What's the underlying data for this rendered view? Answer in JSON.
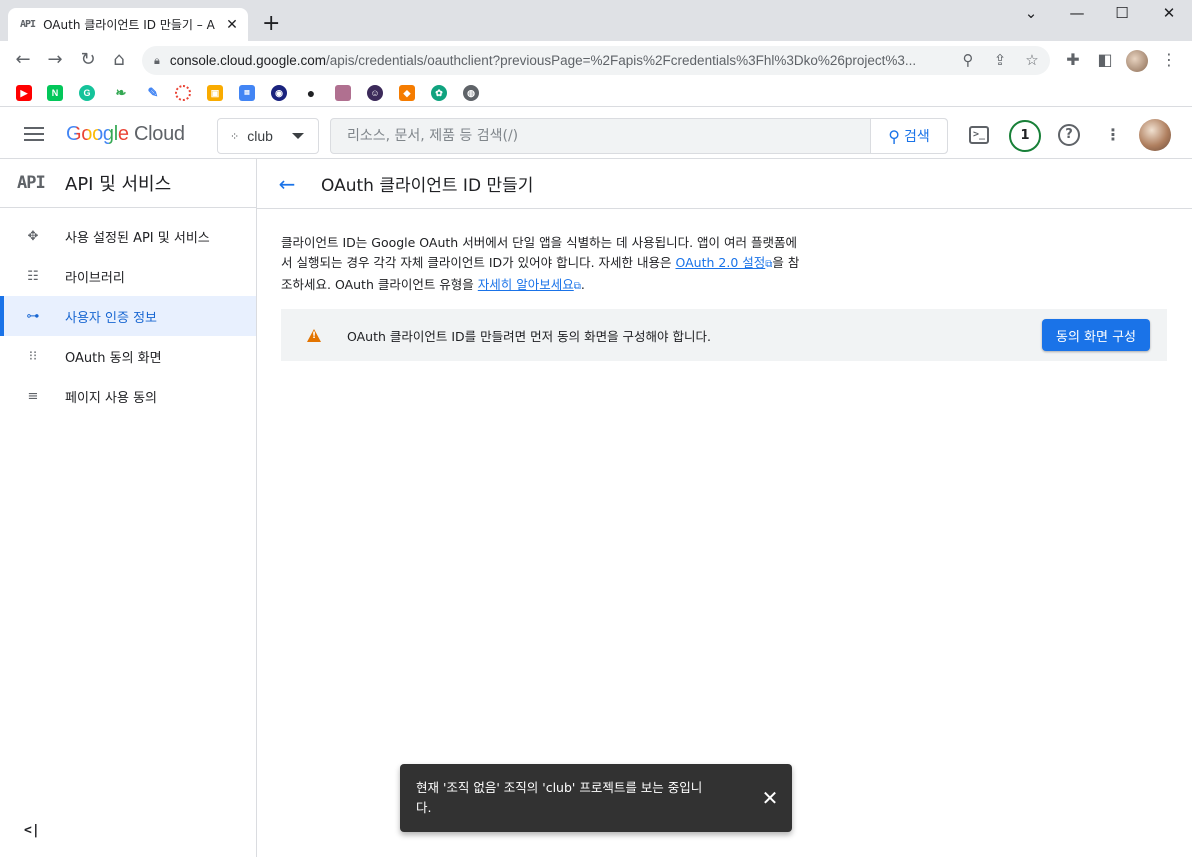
{
  "browser": {
    "tab_title": "OAuth 클라이언트 ID 만들기 – A",
    "tab_favicon": "API",
    "url_host": "console.cloud.google.com",
    "url_path": "/apis/credentials/oauthclient?previousPage=%2Fapis%2Fcredentials%3Fhl%3Dko%26project%3...",
    "bookmarks": [
      "youtube-icon",
      "naver-icon",
      "grammarly-icon",
      "leaf-icon",
      "feather-icon",
      "target-icon",
      "classroom-icon",
      "app-icon",
      "owl-icon",
      "github-icon",
      "photo-icon",
      "robot-icon",
      "box-icon",
      "openai-icon",
      "globe-icon"
    ]
  },
  "header": {
    "logo_google": "Google",
    "logo_cloud": "Cloud",
    "project_name": "club",
    "search_placeholder": "리소스, 문서, 제품 등 검색(/)",
    "search_button": "검색",
    "notifications_count": "1",
    "terminal_glyph": ">_",
    "help_glyph": "?"
  },
  "sidebar": {
    "head_icon": "API",
    "title": "API 및 서비스",
    "items": [
      {
        "label": "사용 설정된 API 및 서비스",
        "icon": "apis-icon",
        "glyph": "✥"
      },
      {
        "label": "라이브러리",
        "icon": "library-icon",
        "glyph": "☷"
      },
      {
        "label": "사용자 인증 정보",
        "icon": "key-icon",
        "glyph": "⊶"
      },
      {
        "label": "OAuth 동의 화면",
        "icon": "consent-icon",
        "glyph": "⁝⁝"
      },
      {
        "label": "페이지 사용 동의",
        "icon": "page-agreement-icon",
        "glyph": "≡"
      }
    ],
    "collapse_glyph": "<|"
  },
  "main": {
    "title": "OAuth 클라이언트 ID 만들기",
    "desc_part1": "클라이언트 ID는 Google OAuth 서버에서 단일 앱을 식별하는 데 사용됩니다. 앱이 여러 플랫폼에서 실행되는 경우 각각 자체 클라이언트 ID가 있어야 합니다. 자세한 내용은 ",
    "desc_link1": "OAuth 2.0 설정",
    "desc_part2": "을 참조하세요. OAuth 클라이언트 유형을 ",
    "desc_link2": "자세히 알아보세요",
    "desc_part3": ".",
    "banner_text": "OAuth 클라이언트 ID를 만들려면 먼저 동의 화면을 구성해야 합니다.",
    "banner_button": "동의 화면 구성"
  },
  "snackbar": {
    "text": "현재 '조직 없음' 조직의 'club' 프로젝트를 보는 중입니다."
  },
  "colors": {
    "accent": "#1a73e8",
    "warning": "#e37400",
    "notification_ring": "#188038"
  }
}
